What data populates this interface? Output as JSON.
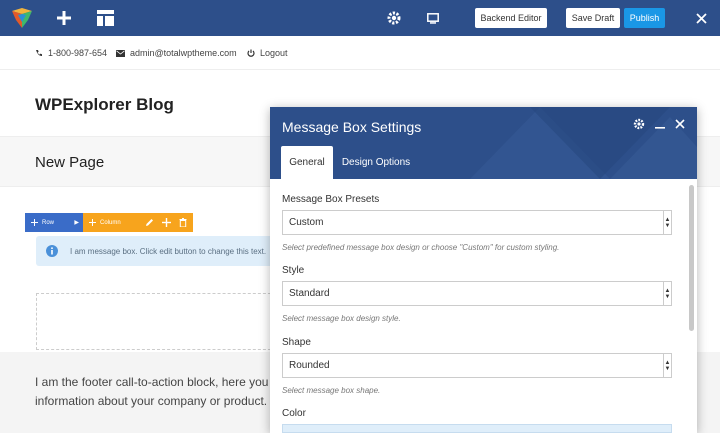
{
  "topbar": {
    "backend_editor": "Backend Editor",
    "save_draft": "Save Draft",
    "publish": "Publish",
    "colors": {
      "bar": "#2d4f8a",
      "publish": "#1a97e6"
    }
  },
  "contact": {
    "phone": "1-800-987-654",
    "email": "admin@totalwptheme.com",
    "logout": "Logout"
  },
  "site": {
    "title": "WPExplorer Blog"
  },
  "page": {
    "title": "New Page"
  },
  "builder": {
    "row_label": "Row",
    "column_label": "Column",
    "message_text": "I am message box. Click edit button to change this text."
  },
  "footer": {
    "line1": "I am the footer call-to-action block, here you can add some relevant/important",
    "line2": "information about your company or product. I can be disabled in the theme options."
  },
  "panel": {
    "title": "Message Box Settings",
    "tabs": [
      "General",
      "Design Options"
    ],
    "fields": {
      "presets": {
        "label": "Message Box Presets",
        "value": "Custom",
        "desc": "Select predefined message box design or choose \"Custom\" for custom styling."
      },
      "style": {
        "label": "Style",
        "value": "Standard",
        "desc": "Select message box design style."
      },
      "shape": {
        "label": "Shape",
        "value": "Rounded",
        "desc": "Select message box shape."
      },
      "color": {
        "label": "Color"
      }
    }
  }
}
